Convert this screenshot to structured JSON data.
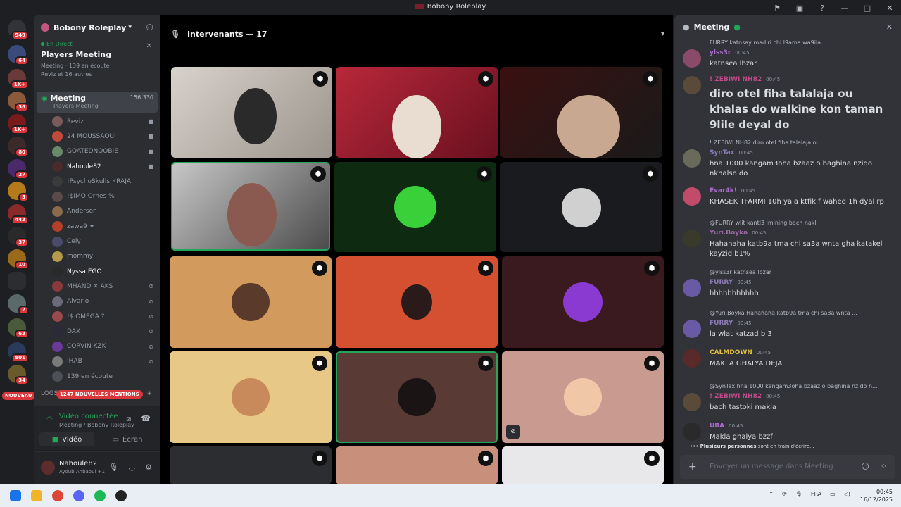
{
  "window": {
    "title": "Bobony Roleplay"
  },
  "servers": [
    {
      "badge": "949"
    },
    {
      "badge": "64"
    },
    {
      "badge": "1K+"
    },
    {
      "badge": "36"
    },
    {
      "badge": "1K+"
    },
    {
      "badge": "80"
    },
    {
      "badge": "27"
    },
    {
      "badge": "5"
    },
    {
      "badge": "443"
    },
    {
      "badge": "37"
    },
    {
      "badge": "10"
    },
    {
      "badge": ""
    },
    {
      "badge": "2"
    },
    {
      "badge": "63"
    },
    {
      "badge": "801"
    },
    {
      "badge": "34"
    }
  ],
  "new_label": "NOUVEAU",
  "sidebar": {
    "guild_name": "Bobony Roleplay",
    "live_tag": "En Direct",
    "live_title": "Players Meeting",
    "live_sub": "Meeting · 139 en écoute",
    "live_sub2": "Reviz et 16 autres",
    "channel_name": "Meeting",
    "channel_desc": "Players Meeting",
    "channel_stats": "156  330",
    "users": [
      {
        "name": "Reviz",
        "color": "#7a5a5a",
        "icon": "▶"
      },
      {
        "name": "24 MOUSSAOUI",
        "color": "#c14a3a",
        "icon": "▶"
      },
      {
        "name": "GOATEDNOOBIE",
        "color": "#6a8a6a",
        "icon": "▶"
      },
      {
        "name": "Nahoule82",
        "color": "#4a2a2a",
        "icon": "▶"
      },
      {
        "name": "!PsychoSkulls ⚡RAJA",
        "color": "#3a3a3a",
        "icon": ""
      },
      {
        "name": "!$IMO Ornes %",
        "color": "#5a4a4a",
        "icon": ""
      },
      {
        "name": "Anderson",
        "color": "#8a6a4a",
        "icon": ""
      },
      {
        "name": "zawa9 ✦",
        "color": "#b5402a",
        "icon": ""
      },
      {
        "name": "Cely",
        "color": "#4a4a6a",
        "icon": ""
      },
      {
        "name": "mommy",
        "color": "#b59a4a",
        "icon": ""
      },
      {
        "name": "Nyssa  EGO",
        "color": "#2a2a2a",
        "icon": ""
      },
      {
        "name": "MHAND ✕  AKS",
        "color": "#8a3a3a",
        "icon": "⊘"
      },
      {
        "name": "Alvario",
        "color": "#6a6a7a",
        "icon": "⊘"
      },
      {
        "name": "!$ OMEGA ?",
        "color": "#9a4a4a",
        "icon": "⊘"
      },
      {
        "name": "DAX",
        "color": "#2a2a3a",
        "icon": "⊘"
      },
      {
        "name": "CORVIN  KZK",
        "color": "#6a3a9a",
        "icon": "⊘"
      },
      {
        "name": "IHAB",
        "color": "#7a7a7a",
        "icon": "⊘"
      }
    ],
    "listeners": "139 en écoute",
    "logs": "LOGS",
    "mentions": "1247 NOUVELLES MENTIONS"
  },
  "voice_panel": {
    "status": "Vidéo connectée",
    "sub": "Meeting / Bobony Roleplay",
    "video_btn": "Vidéo",
    "screen_btn": "Écran"
  },
  "user_panel": {
    "name": "Nahoule82",
    "activity": "Ayoub Anbaoui +1"
  },
  "stage": {
    "speakers_label": "Intervenants — 17"
  },
  "chat": {
    "title": "Meeting",
    "messages": [
      {
        "reply": "FURRY katnsay madiri chi l9ama wa9ila",
        "author": "ylss3r",
        "author_color": "#b06acf",
        "time": "00:45",
        "text": "katnsea lbzar",
        "big": false,
        "avatar": "#8a4a6a"
      },
      {
        "reply": "",
        "author": "! ZEBIWI  NH82",
        "author_color": "#c04a8a",
        "time": "00:45",
        "text": "diro otel fiha talalaja ou khalas do walkine kon taman 9lile deyal do",
        "big": true,
        "avatar": "#5a4a3a"
      },
      {
        "reply": "! ZEBIWI  NH82 diro otel fiha talalaja ou ...",
        "author": "SynTax",
        "author_color": "#8a7ab5",
        "time": "00:45",
        "text": "hna 1000 kangam3oha bzaaz o baghina nzido nkhalso do",
        "big": false,
        "avatar": "#6a6a5a"
      },
      {
        "reply": "",
        "author": "Evar4k!",
        "author_color": "#b06acf",
        "time": "00:45",
        "text": "KHASEK TFARMI 10h yala ktfik f wahed 1h dyal  rp",
        "big": false,
        "avatar": "#c24a6a"
      },
      {
        "reply": "@FURRY wlit kantl3 lmining bach nakl",
        "author": "Yuri.Boyka",
        "author_color": "#9a6aa5",
        "time": "00:45",
        "text": "Hahahaha katb9a tma chi sa3a wnta gha katakel kayzid b1%",
        "big": false,
        "avatar": "#3a3a2a"
      },
      {
        "reply": "@ylss3r katnsea lbzar",
        "author": "FURRY",
        "author_color": "#8a7ab5",
        "time": "00:45",
        "text": "hhhhhhhhhhh",
        "big": false,
        "avatar": "#6a5aa5"
      },
      {
        "reply": "@Yuri.Boyka  Hahahaha katb9a tma chi sa3a wnta ...",
        "author": "FURRY",
        "author_color": "#8a7ab5",
        "time": "00:45",
        "text": "la wlat katzad b 3",
        "big": false,
        "avatar": "#6a5aa5"
      },
      {
        "reply": "",
        "author": "CALMDOWN",
        "author_color": "#e0c040",
        "time": "00:45",
        "text": "MAKLA GHALYA DEJA",
        "big": false,
        "avatar": "#5a2a2a"
      },
      {
        "reply": "@SynTax hna 1000 kangam3oha bzaaz o baghina nzido n...",
        "author": "! ZEBIWI  NH82",
        "author_color": "#c04a8a",
        "time": "00:45",
        "text": "bach tastoki makla",
        "big": false,
        "avatar": "#5a4a3a"
      },
      {
        "reply": "",
        "author": "UBA",
        "author_color": "#b06acf",
        "time": "00:45",
        "text": "Makla ghalya bzzf",
        "big": false,
        "avatar": "#2a2a2a"
      }
    ],
    "typing_who": "Plusieurs personnes",
    "typing_rest": "sont en train d'écrire...",
    "input_placeholder": "Envoyer un message dans Meeting"
  },
  "taskbar": {
    "lang": "FRA",
    "time": "00:45",
    "date": "16/12/2025"
  }
}
